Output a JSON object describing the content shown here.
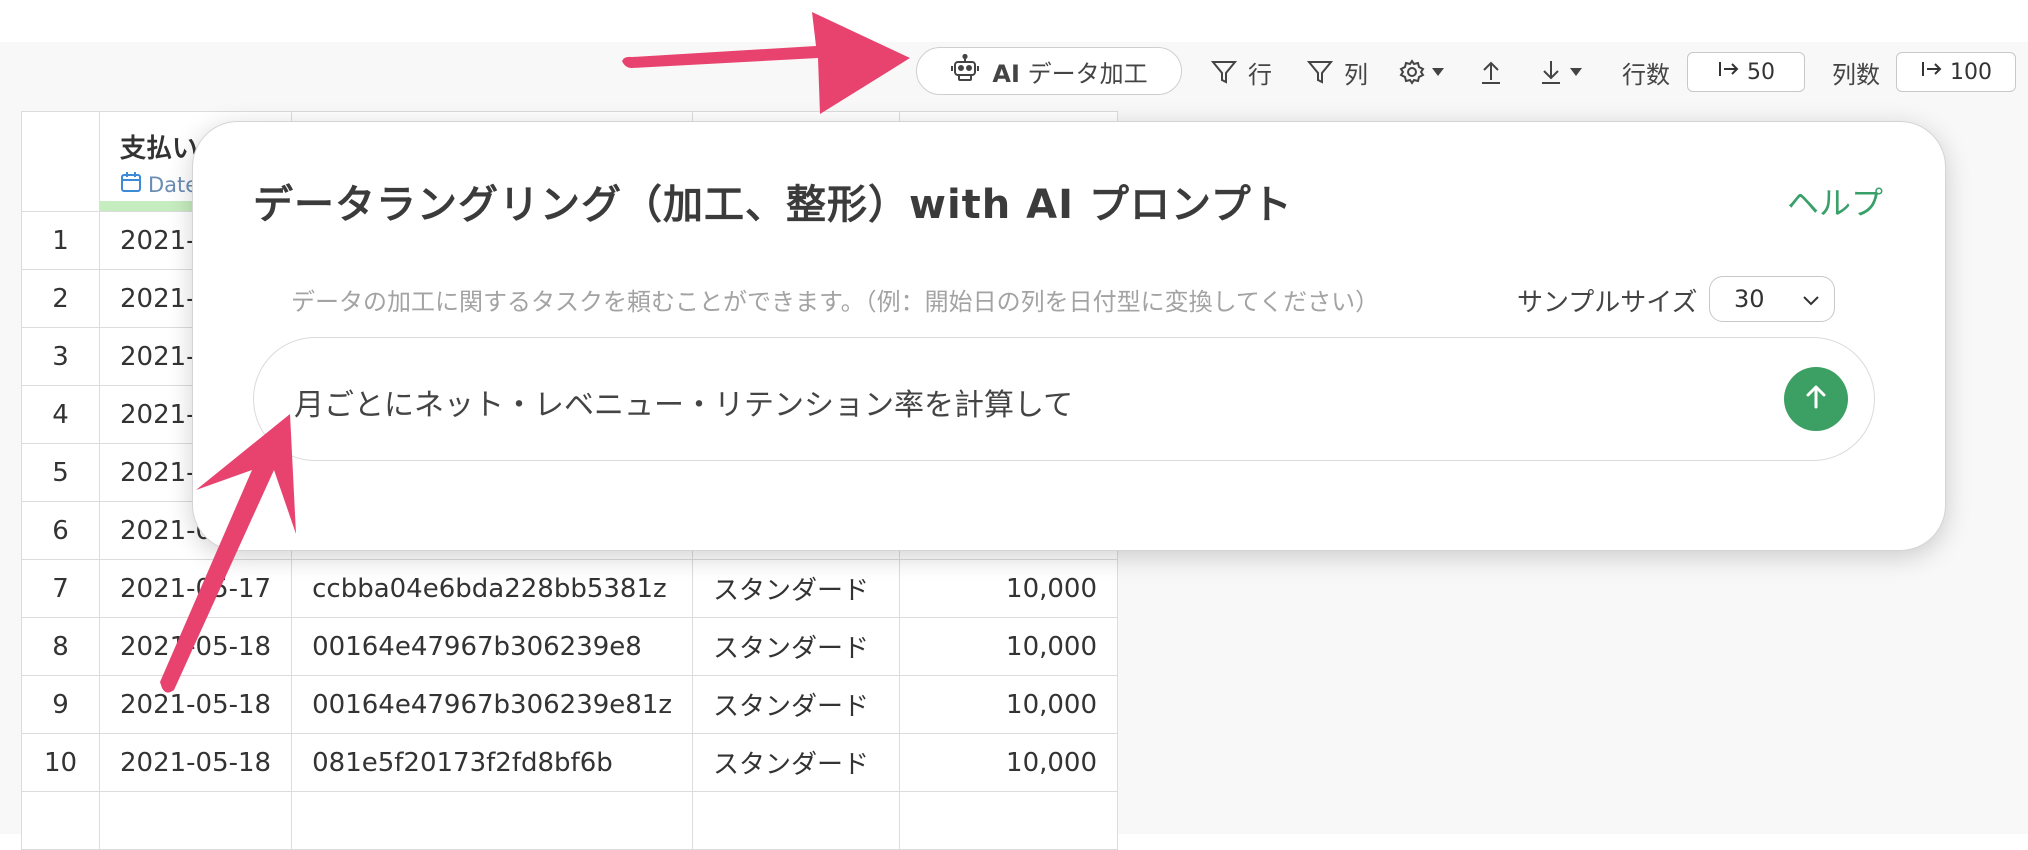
{
  "toolbar": {
    "ai_label_bold": "AI",
    "ai_label_text": "データ加工",
    "row_filter_label": "行",
    "col_filter_label": "列",
    "rows_label": "行数",
    "rows_value": "50",
    "cols_label": "列数",
    "cols_value": "100",
    "icons": [
      "robot-icon",
      "filter-icon",
      "gear-icon",
      "upload-icon",
      "download-icon",
      "chevron-down-icon"
    ]
  },
  "table": {
    "header": {
      "col1_name": "支払い",
      "col1_type": "Date"
    },
    "rows": [
      {
        "num": "1",
        "date": "2021-"
      },
      {
        "num": "2",
        "date": "2021-"
      },
      {
        "num": "3",
        "date": "2021-"
      },
      {
        "num": "4",
        "date": "2021-"
      },
      {
        "num": "5",
        "date": "2021-"
      },
      {
        "num": "6",
        "date": "2021-0"
      },
      {
        "num": "7",
        "date": "2021-05-17",
        "id": "ccbba04e6bda228bb5381z",
        "plan": "スタンダード",
        "amount": "10,000"
      },
      {
        "num": "8",
        "date": "2021-05-18",
        "id": "00164e47967b306239e8",
        "plan": "スタンダード",
        "amount": "10,000"
      },
      {
        "num": "9",
        "date": "2021-05-18",
        "id": "00164e47967b306239e81z",
        "plan": "スタンダード",
        "amount": "10,000"
      },
      {
        "num": "10",
        "date": "2021-05-18",
        "id": "081e5f20173f2fd8bf6b",
        "plan": "スタンダード",
        "amount": "10,000"
      }
    ]
  },
  "popup": {
    "title": "データラングリング（加工、整形）with AI プロンプト",
    "help": "ヘルプ",
    "description": "データの加工に関するタスクを頼むことができます。（例：開始日の列を日付型に変換してください）",
    "sample_label": "サンプルサイズ",
    "sample_value": "30",
    "prompt_text": "月ごとにネット・レベニュー・リテンション率を計算して"
  },
  "colors": {
    "accent_green": "#3c9f63",
    "help_green": "#3aa06a",
    "arrow_pink": "#e8436f",
    "date_type_blue": "#3d8ad6"
  }
}
